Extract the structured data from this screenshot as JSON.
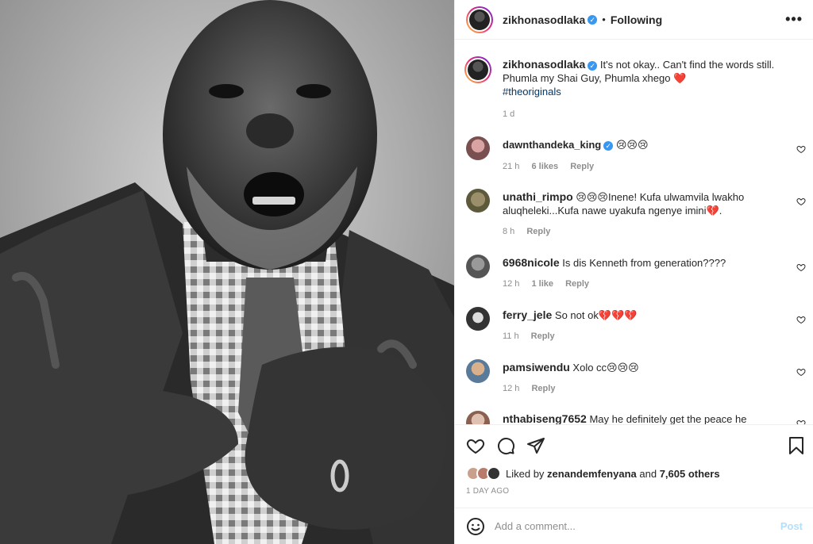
{
  "header": {
    "username": "zikhonasodlaka",
    "separator": "•",
    "follow_status": "Following",
    "more_label": "•••"
  },
  "caption": {
    "username": "zikhonasodlaka",
    "text": "It's not okay.. Can't find the words still. Phumla my Shai Guy, Phumla xhego ❤️",
    "hashtag": "#theoriginals",
    "time": "1 d"
  },
  "comments": [
    {
      "username": "dawnthandeka_king",
      "verified": true,
      "text": "😢😢😢",
      "time": "21 h",
      "likes": "6 likes",
      "reply": "Reply"
    },
    {
      "username": "unathi_rimpo",
      "verified": false,
      "text": "😢😢😢Inene! Kufa ulwamvila lwakho aluqheleki...Kufa nawe uyakufa ngenye imini💔.",
      "time": "8 h",
      "likes": "",
      "reply": "Reply"
    },
    {
      "username": "6968nicole",
      "verified": false,
      "text": "Is dis Kenneth from generation????",
      "time": "12 h",
      "likes": "1 like",
      "reply": "Reply"
    },
    {
      "username": "ferry_jele",
      "verified": false,
      "text": "So not ok💔💔💔",
      "time": "11 h",
      "likes": "",
      "reply": "Reply"
    },
    {
      "username": "pamsiwendu",
      "verified": false,
      "text": "Xolo cc😢😢😢",
      "time": "12 h",
      "likes": "",
      "reply": "Reply"
    },
    {
      "username": "nthabiseng7652",
      "verified": false,
      "text": "May he definitely get the peace he",
      "time": "",
      "likes": "",
      "reply": ""
    }
  ],
  "likes": {
    "prefix": "Liked by",
    "user": "zenandemfenyana",
    "conjunction": "and",
    "others": "7,605 others"
  },
  "post_age": "1 DAY AGO",
  "composer": {
    "placeholder": "Add a comment...",
    "post_label": "Post"
  },
  "colors": {
    "link": "#00376b",
    "verified": "#3897f0",
    "post_disabled": "#b2dffc",
    "muted": "#8e8e8e"
  },
  "icons": [
    "heart-icon",
    "comment-icon",
    "share-icon",
    "bookmark-icon",
    "emoji-icon",
    "more-icon",
    "verified-icon"
  ]
}
